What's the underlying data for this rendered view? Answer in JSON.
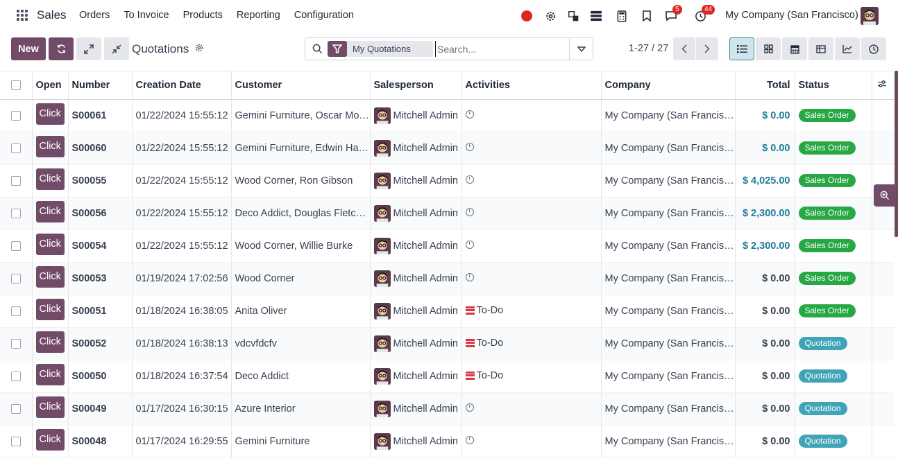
{
  "navbar": {
    "app_name": "Sales",
    "menu": [
      "Orders",
      "To Invoice",
      "Products",
      "Reporting",
      "Configuration"
    ],
    "messages_count": "5",
    "activities_count": "44",
    "company": "My Company (San Francisco)"
  },
  "control": {
    "new_label": "New",
    "title": "Quotations",
    "filter_facet": "My Quotations",
    "search_placeholder": "Search...",
    "pager": "1-27 / 27"
  },
  "table": {
    "headers": {
      "open": "Open",
      "number": "Number",
      "creation_date": "Creation Date",
      "customer": "Customer",
      "salesperson": "Salesperson",
      "activities": "Activities",
      "company": "Company",
      "total": "Total",
      "status": "Status"
    },
    "rows": [
      {
        "open": "Click",
        "number": "S00061",
        "date": "01/22/2024 15:55:12",
        "customer": "Gemini Furniture, Oscar Morgan",
        "salesperson": "Mitchell Admin",
        "activity": "",
        "company": "My Company (San Francisco)",
        "total": "$ 0.00",
        "status": "Sales Order",
        "blue": true
      },
      {
        "open": "Click",
        "number": "S00060",
        "date": "01/22/2024 15:55:12",
        "customer": "Gemini Furniture, Edwin Hansen",
        "salesperson": "Mitchell Admin",
        "activity": "",
        "company": "My Company (San Francisco)",
        "total": "$ 0.00",
        "status": "Sales Order",
        "blue": true
      },
      {
        "open": "Click",
        "number": "S00055",
        "date": "01/22/2024 15:55:12",
        "customer": "Wood Corner, Ron Gibson",
        "salesperson": "Mitchell Admin",
        "activity": "",
        "company": "My Company (San Francisco)",
        "total": "$ 4,025.00",
        "status": "Sales Order",
        "blue": true
      },
      {
        "open": "Click",
        "number": "S00056",
        "date": "01/22/2024 15:55:12",
        "customer": "Deco Addict, Douglas Fletcher",
        "salesperson": "Mitchell Admin",
        "activity": "",
        "company": "My Company (San Francisco)",
        "total": "$ 2,300.00",
        "status": "Sales Order",
        "blue": true
      },
      {
        "open": "Click",
        "number": "S00054",
        "date": "01/22/2024 15:55:12",
        "customer": "Wood Corner, Willie Burke",
        "salesperson": "Mitchell Admin",
        "activity": "",
        "company": "My Company (San Francisco)",
        "total": "$ 2,300.00",
        "status": "Sales Order",
        "blue": true
      },
      {
        "open": "Click",
        "number": "S00053",
        "date": "01/19/2024 17:02:56",
        "customer": "Wood Corner",
        "salesperson": "Mitchell Admin",
        "activity": "",
        "company": "My Company (San Francisco)",
        "total": "$ 0.00",
        "status": "Sales Order",
        "blue": false
      },
      {
        "open": "Click",
        "number": "S00051",
        "date": "01/18/2024 16:38:05",
        "customer": "Anita Oliver",
        "salesperson": "Mitchell Admin",
        "activity": "To-Do",
        "company": "My Company (San Francisco)",
        "total": "$ 0.00",
        "status": "Sales Order",
        "blue": false
      },
      {
        "open": "Click",
        "number": "S00052",
        "date": "01/18/2024 16:38:13",
        "customer": "vdcvfdcfv",
        "salesperson": "Mitchell Admin",
        "activity": "To-Do",
        "company": "My Company (San Francisco)",
        "total": "$ 0.00",
        "status": "Quotation",
        "blue": false
      },
      {
        "open": "Click",
        "number": "S00050",
        "date": "01/18/2024 16:37:54",
        "customer": "Deco Addict",
        "salesperson": "Mitchell Admin",
        "activity": "To-Do",
        "company": "My Company (San Francisco)",
        "total": "$ 0.00",
        "status": "Quotation",
        "blue": false
      },
      {
        "open": "Click",
        "number": "S00049",
        "date": "01/17/2024 16:30:15",
        "customer": "Azure Interior",
        "salesperson": "Mitchell Admin",
        "activity": "",
        "company": "My Company (San Francisco)",
        "total": "$ 0.00",
        "status": "Quotation",
        "blue": false
      },
      {
        "open": "Click",
        "number": "S00048",
        "date": "01/17/2024 16:29:55",
        "customer": "Gemini Furniture",
        "salesperson": "Mitchell Admin",
        "activity": "",
        "company": "My Company (San Francisco)",
        "total": "$ 0.00",
        "status": "Quotation",
        "blue": false
      }
    ]
  },
  "colors": {
    "brand": "#714b67",
    "sales_order": "#28a745",
    "quotation": "#3fa4b7",
    "total_blue": "#1e7c99"
  }
}
